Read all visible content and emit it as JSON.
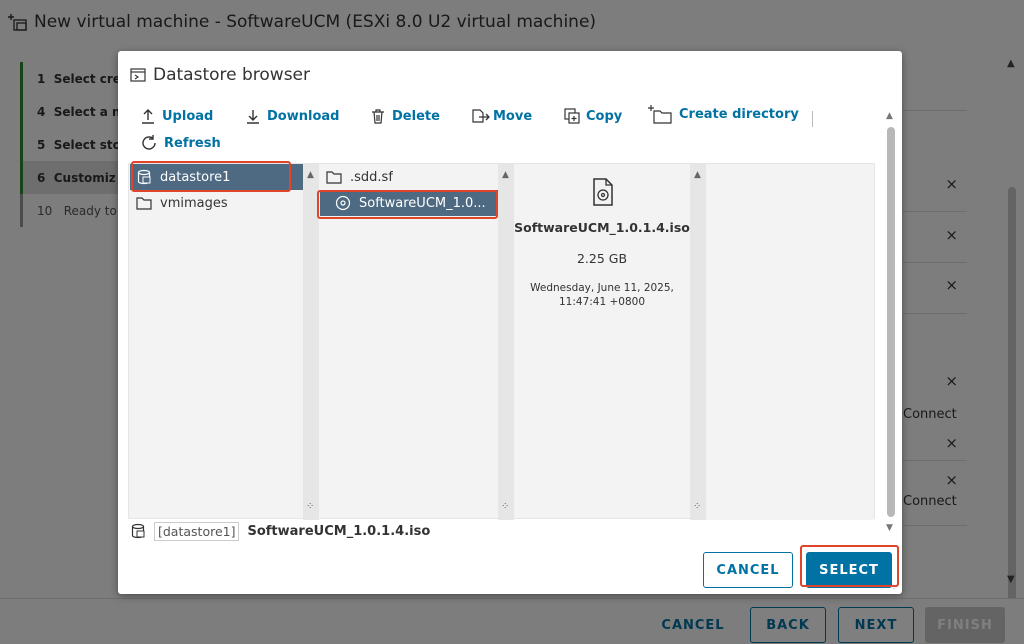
{
  "wizard": {
    "title": "New virtual machine - SoftwareUCM (ESXi 8.0 U2 virtual machine)",
    "steps": [
      {
        "num": "1",
        "label": "Select cre"
      },
      {
        "num": "4",
        "label": "Select a n"
      },
      {
        "num": "5",
        "label": "Select sto"
      },
      {
        "num": "6",
        "label": "Customiz"
      },
      {
        "num": "10",
        "label": "Ready to"
      }
    ],
    "connect_labels": [
      "Connect",
      "Connect"
    ],
    "close_mark": "×",
    "buttons": {
      "cancel": "CANCEL",
      "back": "BACK",
      "next": "NEXT",
      "finish": "FINISH"
    }
  },
  "modal": {
    "title": "Datastore browser",
    "toolbar": {
      "upload": "Upload",
      "download": "Download",
      "delete": "Delete",
      "move": "Move",
      "copy": "Copy",
      "create_directory": "Create directory",
      "refresh": "Refresh"
    },
    "datastores": [
      {
        "name": "datastore1",
        "selected": true
      },
      {
        "name": "vmimages",
        "selected": false
      }
    ],
    "files": [
      {
        "name": ".sdd.sf",
        "type": "folder",
        "selected": false
      },
      {
        "name": "SoftwareUCM_1.0...",
        "type": "disc",
        "selected": true
      }
    ],
    "detail": {
      "name": "SoftwareUCM_1.0.1.4.iso",
      "size": "2.25 GB",
      "date_line1": "Wednesday, June 11, 2025,",
      "date_line2": "11:47:41 +0800"
    },
    "path": {
      "datastore_tag": "[datastore1]",
      "file": "SoftwareUCM_1.0.1.4.iso"
    },
    "buttons": {
      "cancel": "CANCEL",
      "select": "SELECT"
    }
  },
  "colors": {
    "accent": "#0072a3",
    "selection": "#4e6a82",
    "highlight": "#e0452b",
    "step_done": "#2e8b2e"
  }
}
